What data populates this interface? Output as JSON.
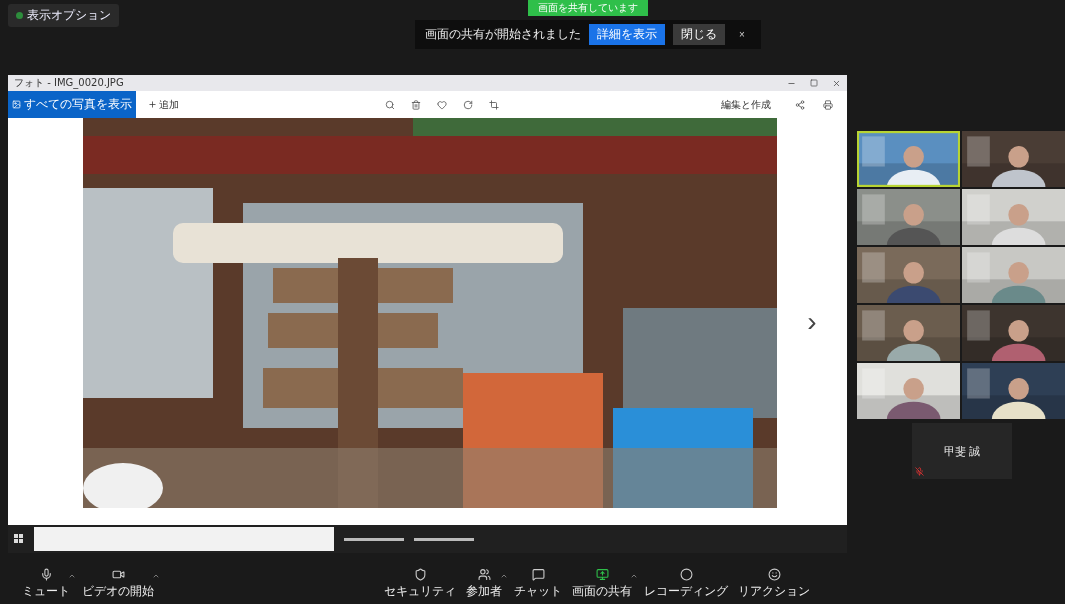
{
  "top_bar": {
    "view_options": "表示オプション",
    "status_banner": "画面を共有しています",
    "notice": {
      "text": "画面の共有が開始されました",
      "primary_button": "詳細を表示",
      "secondary_button": "閉じる",
      "close": "×"
    }
  },
  "photo_window": {
    "title": "フォト - IMG_0020.JPG",
    "all_photos": "すべての写真を表示",
    "add": "追加",
    "edit": "編集と作成",
    "next": "›"
  },
  "gallery": {
    "tiles": [
      {
        "active": true
      },
      {
        "active": false
      },
      {
        "active": false
      },
      {
        "active": false
      },
      {
        "active": false
      },
      {
        "active": false
      },
      {
        "active": false
      },
      {
        "active": false
      },
      {
        "active": false
      },
      {
        "active": false
      }
    ],
    "name_tile": {
      "name": "甲斐 誠",
      "muted": true
    }
  },
  "toolbar": [
    {
      "kind": "mic",
      "label": "ミュート",
      "caret": true
    },
    {
      "kind": "video",
      "label": "ビデオの開始",
      "caret": true
    },
    {
      "kind": "security",
      "label": "セキュリティ",
      "caret": false
    },
    {
      "kind": "participants",
      "label": "参加者",
      "caret": true
    },
    {
      "kind": "chat",
      "label": "チャット",
      "caret": false
    },
    {
      "kind": "share",
      "label": "画面の共有",
      "caret": true
    },
    {
      "kind": "record",
      "label": "レコーディング",
      "caret": false
    },
    {
      "kind": "reactions",
      "label": "リアクション",
      "caret": false
    }
  ]
}
